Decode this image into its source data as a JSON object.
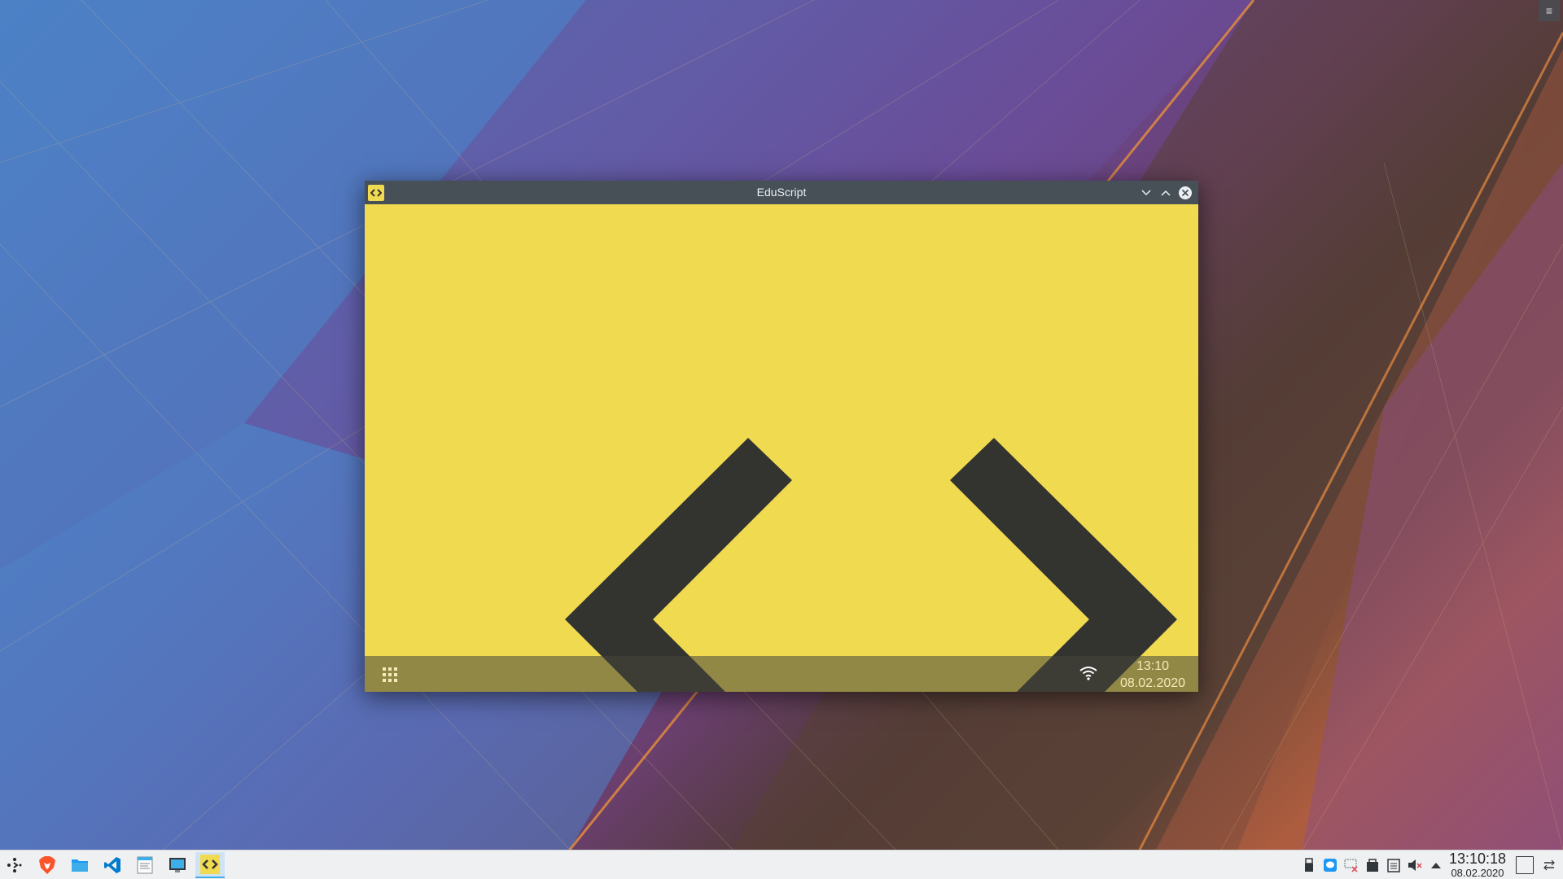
{
  "desktop": {
    "menu_icon": "hamburger-icon"
  },
  "window": {
    "title": "EduScript",
    "app_icon": "eduscript-logo-icon",
    "buttons": [
      "minimize-icon",
      "maximize-icon",
      "close-icon"
    ]
  },
  "app": {
    "logo": "eduscript-angle-brackets-logo",
    "bar": {
      "apps_icon": "app-grid-icon",
      "wifi_icon": "wifi-icon",
      "time": "13:10",
      "date": "08.02.2020"
    }
  },
  "taskbar": {
    "launchers": [
      {
        "name": "application-launcher",
        "icon": "kde-launcher-icon"
      },
      {
        "name": "brave-browser",
        "icon": "brave-icon"
      },
      {
        "name": "file-manager",
        "icon": "folder-icon"
      },
      {
        "name": "vscode",
        "icon": "vscode-icon"
      },
      {
        "name": "text-editor",
        "icon": "text-editor-icon"
      },
      {
        "name": "screenshot-tool",
        "icon": "monitor-icon"
      },
      {
        "name": "eduscript-task",
        "icon": "eduscript-logo-icon",
        "active": true
      }
    ],
    "tray": [
      "usb-icon",
      "chat-icon",
      "network-disconnected-icon",
      "clipboard-icon",
      "notes-icon",
      "volume-muted-icon",
      "expand-tray-icon"
    ],
    "clock": {
      "time": "13:10:18",
      "date": "08.02.2020"
    }
  },
  "colors": {
    "app_yellow": "#f0da50",
    "logo_dark": "#333330",
    "titlebar": "#475057",
    "taskbar": "#eff0f1",
    "accent": "#3daee9"
  }
}
